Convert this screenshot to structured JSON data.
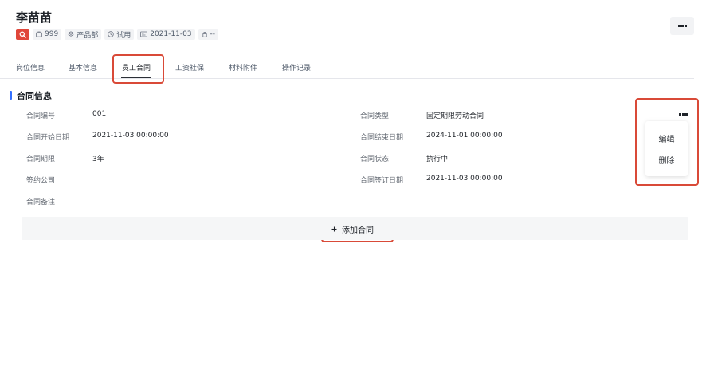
{
  "employee": {
    "name": "李苗苗",
    "tags": [
      {
        "icon": "briefcase-icon",
        "text": "999"
      },
      {
        "icon": "layers-icon",
        "text": "产品部"
      },
      {
        "icon": "clock-icon",
        "text": "试用"
      },
      {
        "icon": "id-card-icon",
        "text": "2021-11-03"
      },
      {
        "icon": "building-icon",
        "text": "--"
      }
    ]
  },
  "tabs": [
    {
      "label": "岗位信息",
      "active": false
    },
    {
      "label": "基本信息",
      "active": false
    },
    {
      "label": "员工合同",
      "active": true
    },
    {
      "label": "工资社保",
      "active": false
    },
    {
      "label": "材料附件",
      "active": false
    },
    {
      "label": "操作记录",
      "active": false
    }
  ],
  "contract": {
    "section_title": "合同信息",
    "fields": [
      {
        "label": "合同编号",
        "value": "001"
      },
      {
        "label": "合同类型",
        "value": "固定期限劳动合同"
      },
      {
        "label": "合同开始日期",
        "value": "2021-11-03 00:00:00"
      },
      {
        "label": "合同结束日期",
        "value": "2024-11-01 00:00:00"
      },
      {
        "label": "合同期限",
        "value": "3年"
      },
      {
        "label": "合同状态",
        "value": "执行中"
      },
      {
        "label": "签约公司",
        "value": ""
      },
      {
        "label": "合同签订日期",
        "value": "2021-11-03 00:00:00"
      },
      {
        "label": "合同备注",
        "value": ""
      }
    ],
    "menu": {
      "edit": "编辑",
      "delete": "删除"
    },
    "add_button": {
      "icon": "plus-icon",
      "label": "添加合同"
    }
  },
  "colors": {
    "accent_red": "#e0463a",
    "section_bar": "#3370ff",
    "highlight": "#d94a38"
  }
}
